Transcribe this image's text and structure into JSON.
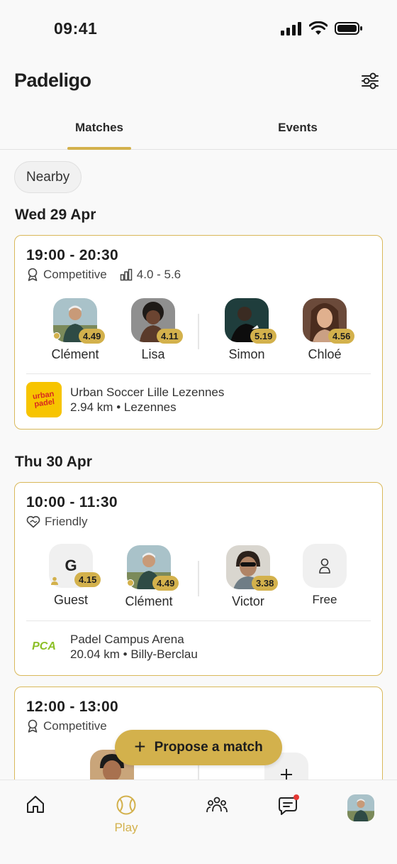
{
  "status": {
    "time": "09:41"
  },
  "app": {
    "logo": "Padeligo"
  },
  "tabs": [
    {
      "label": "Matches"
    },
    {
      "label": "Events"
    }
  ],
  "filter_chip": "Nearby",
  "days": [
    {
      "date": "Wed 29 Apr",
      "matches": [
        {
          "time": "19:00 - 20:30",
          "type": "Competitive",
          "level": "4.0 - 5.6",
          "players": [
            {
              "name": "Clément",
              "rating": "4.49"
            },
            {
              "name": "Lisa",
              "rating": "4.11"
            },
            {
              "name": "Simon",
              "rating": "5.19"
            },
            {
              "name": "Chloé",
              "rating": "4.56"
            }
          ],
          "venue": {
            "name": "Urban Soccer Lille Lezennes",
            "distance": "2.94 km • Lezennes",
            "logo_text": "urban padel"
          }
        }
      ]
    },
    {
      "date": "Thu 30 Apr",
      "matches": [
        {
          "time": "10:00 - 11:30",
          "type": "Friendly",
          "players": [
            {
              "name": "Guest",
              "rating": "4.15",
              "initial": "G"
            },
            {
              "name": "Clément",
              "rating": "4.49"
            },
            {
              "name": "Victor",
              "rating": "3.38"
            },
            {
              "name": "Free"
            }
          ],
          "venue": {
            "name": "Padel Campus Arena",
            "distance": "20.04 km • Billy-Berclau",
            "logo_text": "PCA"
          }
        },
        {
          "time": "12:00 - 13:00",
          "type": "Competitive"
        }
      ]
    }
  ],
  "fab": {
    "label": "Propose a match"
  },
  "bottom_nav": [
    {
      "icon": "home-icon"
    },
    {
      "icon": "tennis-ball-icon",
      "label": "Play"
    },
    {
      "icon": "community-icon"
    },
    {
      "icon": "chat-icon"
    },
    {
      "icon": "profile-avatar"
    }
  ],
  "colors": {
    "accent": "#d3b14c",
    "background": "#f9f9f9",
    "notification": "#e53935"
  }
}
